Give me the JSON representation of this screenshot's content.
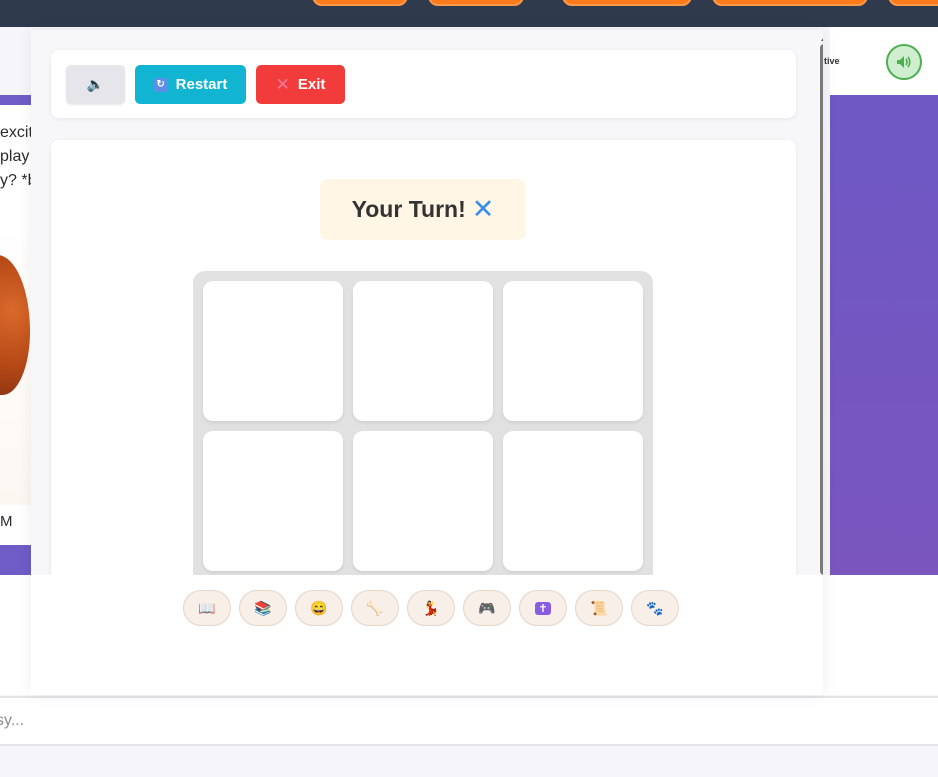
{
  "background": {
    "chat_lines": [
      "excit",
      "play",
      "y? *b",
      "M"
    ],
    "right_label": "tive",
    "sound_icon": "speaker-icon"
  },
  "input": {
    "placeholder": "sy..."
  },
  "controls": {
    "mute_icon": "🔈",
    "restart_label": "Restart",
    "restart_icon": "🔄",
    "exit_label": "Exit",
    "exit_icon": "✕"
  },
  "game": {
    "turn_text": "Your Turn!",
    "turn_symbol": "✕",
    "cells": [
      "",
      "",
      "",
      "",
      "",
      ""
    ]
  },
  "emoji_bar": [
    {
      "name": "book-icon",
      "glyph": "📖"
    },
    {
      "name": "books-icon",
      "glyph": "📚"
    },
    {
      "name": "laughing-face-icon",
      "glyph": "😄"
    },
    {
      "name": "bone-icon",
      "glyph": "🦴"
    },
    {
      "name": "dancer-icon",
      "glyph": "💃"
    },
    {
      "name": "gamepad-icon",
      "glyph": "🎮"
    },
    {
      "name": "cross-icon",
      "glyph": "✝"
    },
    {
      "name": "scroll-icon",
      "glyph": "📜"
    },
    {
      "name": "paw-icon",
      "glyph": "🐾"
    }
  ],
  "colors": {
    "restart": "#12b5d1",
    "exit": "#f23b3b",
    "turn_symbol": "#3a8ee6",
    "accent_purple": "#6f5cc6",
    "top_pill": "#ff7a1a"
  }
}
